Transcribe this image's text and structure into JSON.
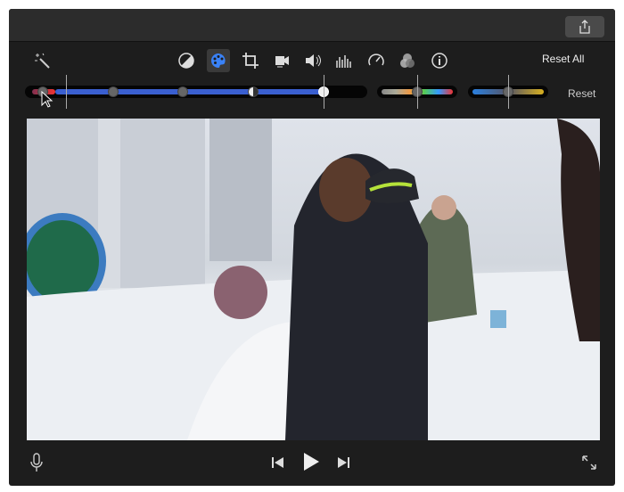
{
  "toolbar": {
    "reset_all_label": "Reset All",
    "reset_label": "Reset",
    "tools": [
      "magic-wand",
      "color-balance",
      "color-correction",
      "crop",
      "stabilization",
      "volume",
      "equalizer",
      "speed",
      "filter",
      "info"
    ],
    "active_tool": "color-correction",
    "accent_color": "#3a82f7"
  },
  "sliders": {
    "exposure_points": 5,
    "saturation_level": 0.5,
    "temperature_level": 0.5
  },
  "playback": {
    "controls": [
      "microphone",
      "skip-back",
      "play",
      "skip-forward",
      "fullscreen"
    ]
  }
}
